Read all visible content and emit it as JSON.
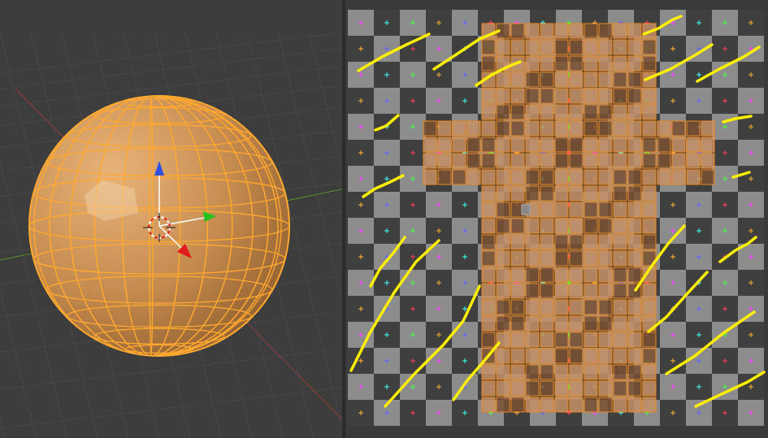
{
  "colors": {
    "viewport_bg": "#3d3d3d",
    "grid_line": "#474747",
    "axis_x": "#b03a3a",
    "axis_y": "#5a8f30",
    "mesh_fill": "#d39a58",
    "mesh_edge": "#ffa830",
    "checker_light": "#8c8c8c",
    "checker_dark": "#3f3f3f",
    "uv_fill": "#c49066",
    "uv_edge": "#f08a20",
    "annotation": "#ffee00",
    "gizmo_z": "#2f4fe0",
    "gizmo_y": "#27c21f",
    "gizmo_x": "#e01a1a"
  },
  "icons": [
    "3d-cursor-icon",
    "transform-gizmo-icon"
  ],
  "cross_mask": [
    "..######..",
    "..######..",
    "..######..",
    "##########",
    "##########",
    "..######..",
    "..######..",
    "..######..",
    "..######..",
    "..######..",
    "..######..",
    "..######.."
  ]
}
